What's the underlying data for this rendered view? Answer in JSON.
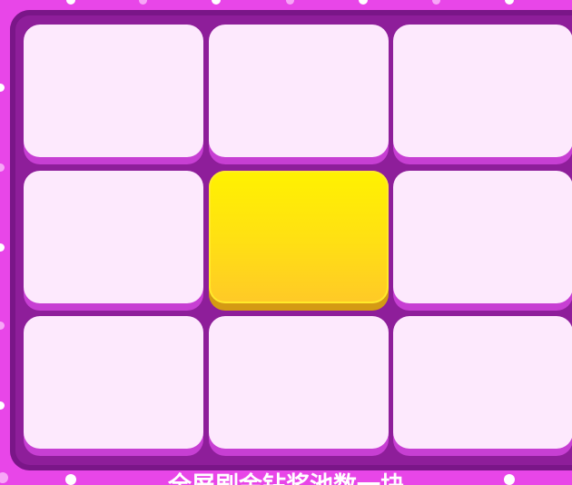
{
  "game": {
    "caption": "全屏刷金钻奖池数一块",
    "grid": {
      "rows": 3,
      "cols": 3,
      "active_index": 4
    },
    "colors": {
      "background": "#e846e8",
      "board": "#8e1e9a",
      "tile": "#fde9fd",
      "tile_shadow": "#c73fd3",
      "active_tile": "#ffe40a"
    }
  }
}
